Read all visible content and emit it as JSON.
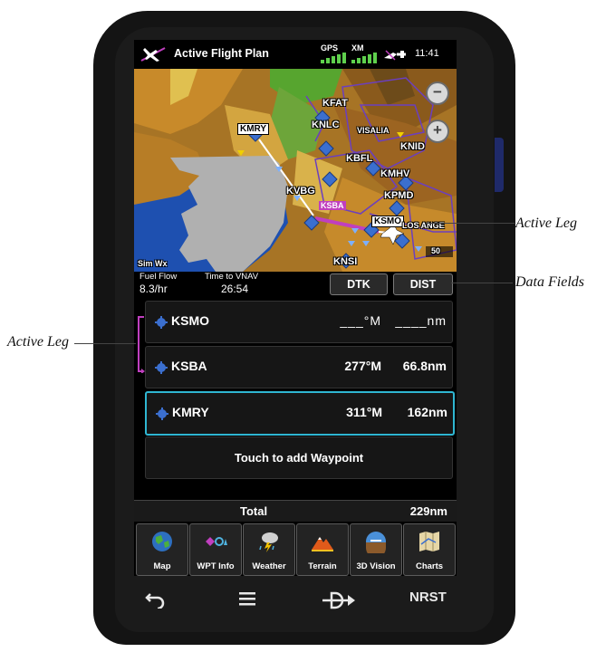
{
  "status_bar": {
    "title": "Active Flight Plan",
    "gps_label": "GPS",
    "xm_label": "XM",
    "time": "11:41"
  },
  "map": {
    "labels": {
      "kmry": "KMRY",
      "kfat": "KFAT",
      "knlc": "KNLC",
      "visalia": "VISALIA",
      "knid": "KNID",
      "kbfl": "KBFL",
      "kmhv": "KMHV",
      "kpmd": "KPMD",
      "kvbg": "KVBG",
      "ksba": "KSBA",
      "ksmo": "KSMO",
      "los_angeles": "LOS ANGE",
      "knsi": "KNSI",
      "sim_wx": "Sim Wx",
      "range": "50"
    },
    "zoom_out": "−",
    "zoom_in": "+"
  },
  "data_fields": {
    "fuel_flow_label": "Fuel Flow",
    "fuel_flow_value": "8.3/hr",
    "time_to_vnav_label": "Time to VNAV",
    "time_to_vnav_value": "26:54",
    "dtk_button": "DTK",
    "dist_button": "DIST"
  },
  "flight_plan": {
    "waypoints": [
      {
        "name": "KSMO",
        "dtk": "___°M",
        "dist": "____nm"
      },
      {
        "name": "KSBA",
        "dtk": "277°M",
        "dist": "66.8nm"
      },
      {
        "name": "KMRY",
        "dtk": "311°M",
        "dist": "162nm"
      }
    ],
    "add_waypoint": "Touch to add Waypoint",
    "total_label": "Total",
    "total_value": "229nm"
  },
  "apps": [
    {
      "label": "Map",
      "icon": "globe-icon"
    },
    {
      "label": "WPT Info",
      "icon": "waypoint-info-icon"
    },
    {
      "label": "Weather",
      "icon": "weather-icon"
    },
    {
      "label": "Terrain",
      "icon": "terrain-icon"
    },
    {
      "label": "3D Vision",
      "icon": "3d-vision-icon"
    },
    {
      "label": "Charts",
      "icon": "charts-icon"
    }
  ],
  "hardware_buttons": {
    "back_icon": "back-arrow-icon",
    "menu_icon": "menu-icon",
    "direct_to_icon": "direct-to-icon",
    "nrst": "NRST"
  },
  "callouts": {
    "active_leg_right": "Active Leg",
    "data_fields": "Data Fields",
    "active_leg_left": "Active Leg"
  },
  "colors": {
    "selection_border": "#2fb6d2",
    "active_leg_magenta": "#c03fbf",
    "signal_green": "#5fd04d"
  }
}
